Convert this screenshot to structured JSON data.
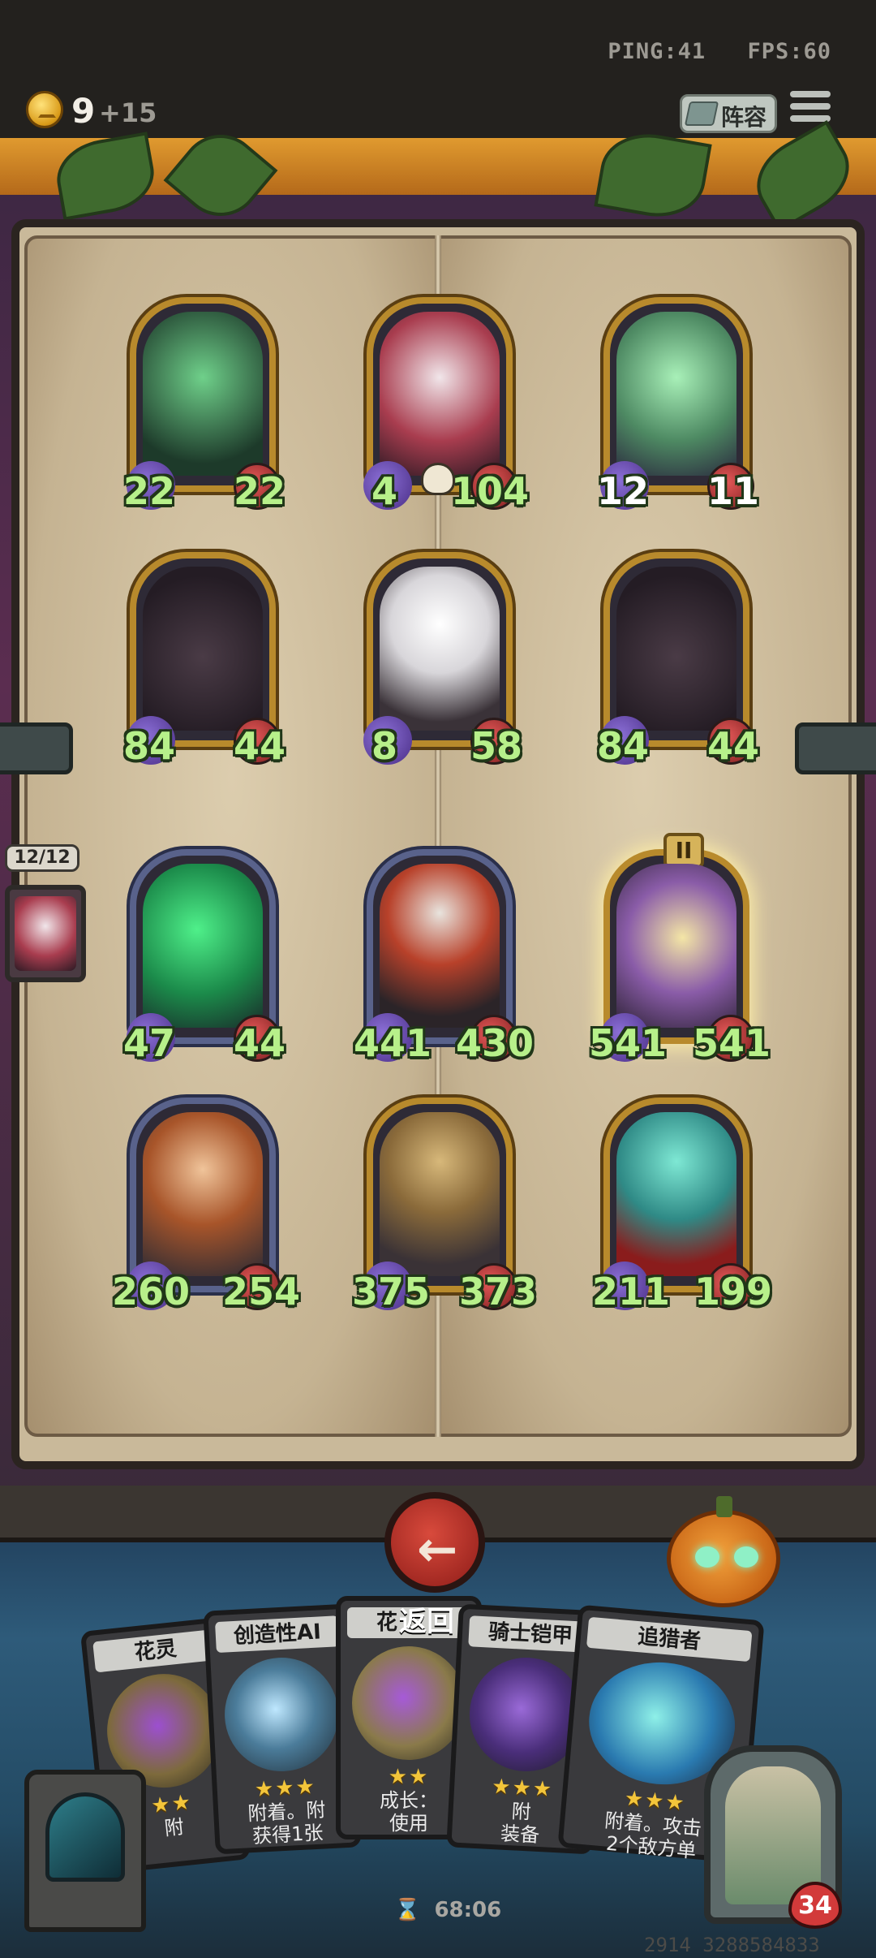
{
  "status": {
    "ping": "PING:41",
    "fps": "FPS:60"
  },
  "resources": {
    "gold": "9",
    "gold_income": "+15"
  },
  "toolbar": {
    "lineup_label": "阵容"
  },
  "board": {
    "rows": [
      [
        {
          "attack": "22",
          "health": "22",
          "art": "green-spectral-crossbow"
        },
        {
          "attack": "4",
          "health": "104",
          "art": "vampire-girl"
        },
        {
          "attack": "12",
          "health": "11",
          "art": "ghost-cat"
        }
      ],
      [
        {
          "attack": "84",
          "health": "44",
          "art": "shadow-bat-crown"
        },
        {
          "attack": "8",
          "health": "58",
          "art": "jack-o-ghost"
        },
        {
          "attack": "84",
          "health": "44",
          "art": "shadow-bat-crown"
        }
      ],
      [
        {
          "attack": "47",
          "health": "44",
          "art": "green-phantom"
        },
        {
          "attack": "441",
          "health": "430",
          "art": "hooded-assassin"
        },
        {
          "attack": "541",
          "health": "541",
          "art": "armored-knight-shield",
          "tier": "II"
        }
      ],
      [
        {
          "attack": "260",
          "health": "254",
          "art": "archer-boy"
        },
        {
          "attack": "375",
          "health": "373",
          "art": "scarecrow-bot"
        },
        {
          "attack": "211",
          "health": "199",
          "art": "spirit-summoner"
        }
      ]
    ]
  },
  "side_panel": {
    "count": "12/12"
  },
  "hand": {
    "return_label": "返回",
    "cards": [
      {
        "title": "花灵",
        "stars": "★★",
        "desc1": "附",
        "desc2": ""
      },
      {
        "title": "创造性AI",
        "stars": "★★★",
        "desc1": "附着。附",
        "desc2": "获得1张"
      },
      {
        "title": "花",
        "stars": "★★",
        "desc1": "成长：",
        "desc2": "使用"
      },
      {
        "title": "骑士铠甲",
        "stars": "★★★",
        "desc1": "附",
        "desc2": "装备"
      },
      {
        "title": "追猎者",
        "stars": "★★★",
        "desc1": "附着。攻击",
        "desc2": "2个敌方单"
      }
    ]
  },
  "player": {
    "health": "34"
  },
  "timer": "68:06",
  "footer": "2914 3288584833",
  "colors": {
    "stat_green": "#b7f08a",
    "gold_frame": "#b88a2c",
    "back_button": "#c3342a"
  }
}
